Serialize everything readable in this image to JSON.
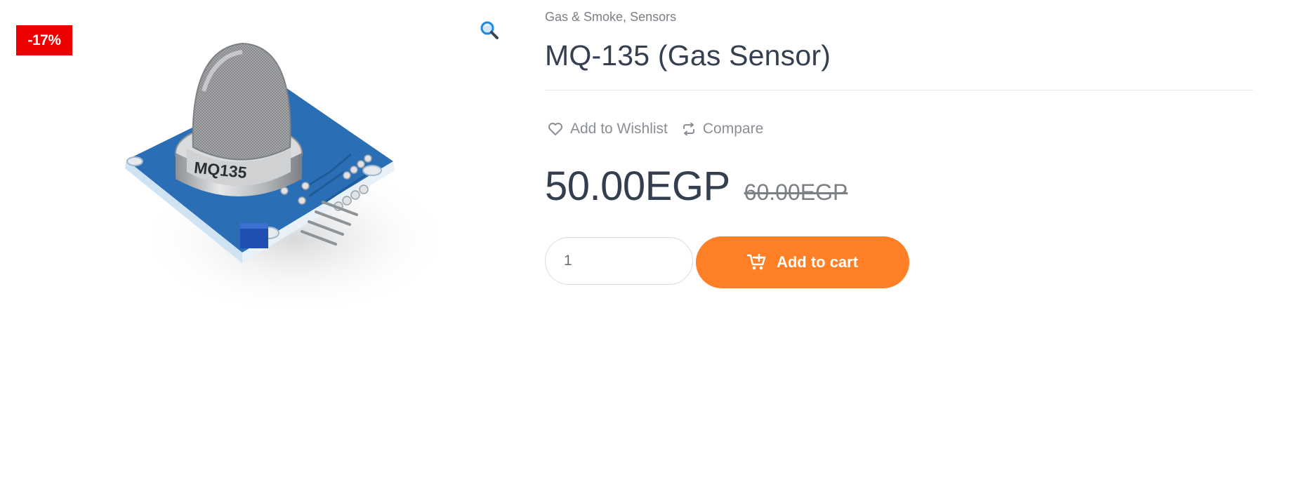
{
  "gallery": {
    "sale_badge": "-17%",
    "zoom_icon": "magnifier-icon",
    "image_label": "MQ135",
    "image_subject": "mq-135-gas-sensor-module"
  },
  "product": {
    "categories": [
      "Gas & Smoke",
      "Sensors"
    ],
    "category_separator": ", ",
    "title": "MQ-135 (Gas Sensor)",
    "actions": {
      "wishlist_label": "Add to Wishlist",
      "wishlist_icon": "heart-icon",
      "compare_label": "Compare",
      "compare_icon": "compare-arrows-icon"
    },
    "price_current": "50.00EGP",
    "price_old": "60.00EGP",
    "quantity": "1",
    "add_to_cart_label": "Add to cart",
    "add_to_cart_icon": "cart-plus-icon"
  },
  "colors": {
    "sale_badge": "#ee0000",
    "add_to_cart": "#ff7f27",
    "pcb_blue": "#2a6fb5",
    "zoom_icon": "#1e88e5"
  }
}
